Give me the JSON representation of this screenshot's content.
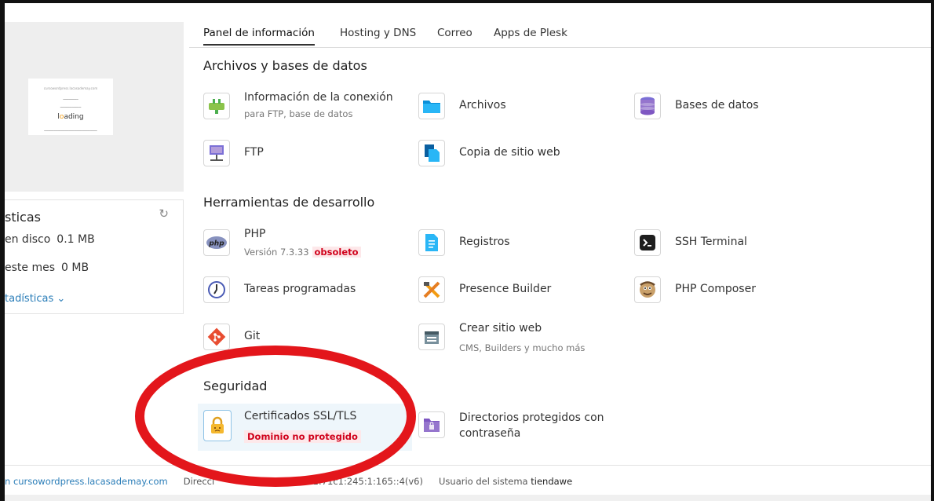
{
  "tabs": [
    "Panel de información",
    "Hosting y DNS",
    "Correo",
    "Apps de Plesk"
  ],
  "preview": {
    "site_line": "cursowordpress.lacasademay.com",
    "loading_prefix": "l",
    "loading_accent": "o",
    "loading_suffix": "ading"
  },
  "stats": {
    "title": "sticas",
    "disk_label": "en disco",
    "disk_value": "0.1 MB",
    "month_label": "este mes",
    "month_value": "0 MB",
    "more_link": "tadísticas ⌄"
  },
  "sections": {
    "files": "Archivos y bases de datos",
    "dev": "Herramientas de desarrollo",
    "security": "Seguridad"
  },
  "tools": {
    "connection": {
      "label": "Información de la conexión",
      "sub": "para FTP, base de datos"
    },
    "files": {
      "label": "Archivos"
    },
    "databases": {
      "label": "Bases de datos"
    },
    "ftp": {
      "label": "FTP"
    },
    "backup": {
      "label": "Copia de sitio web"
    },
    "php": {
      "label": "PHP",
      "sub": "Versión 7.3.33",
      "warn": "obsoleto"
    },
    "logs": {
      "label": "Registros"
    },
    "ssh": {
      "label": "SSH Terminal"
    },
    "cron": {
      "label": "Tareas programadas"
    },
    "presence": {
      "label": "Presence Builder"
    },
    "composer": {
      "label": "PHP Composer"
    },
    "git": {
      "label": "Git"
    },
    "create_site": {
      "label": "Crear sitio web",
      "sub": "CMS, Builders y mucho más"
    },
    "ssl": {
      "label": "Certificados SSL/TLS",
      "badge": "Dominio no protegido"
    },
    "protected_dirs": {
      "line1": "Directorios protegidos con",
      "line2": "contraseña"
    }
  },
  "footer": {
    "domain": "n cursowordpress.lacasademay.com",
    "address": "Direcci",
    "ip": "2a01:71c1:245:1:165::4(v6)",
    "user_label": "Usuario del sistema",
    "user_value": "tiendawe"
  },
  "colors": {
    "accent": "#2a7db8",
    "danger": "#d0021b",
    "annotation": "#e3161b"
  }
}
